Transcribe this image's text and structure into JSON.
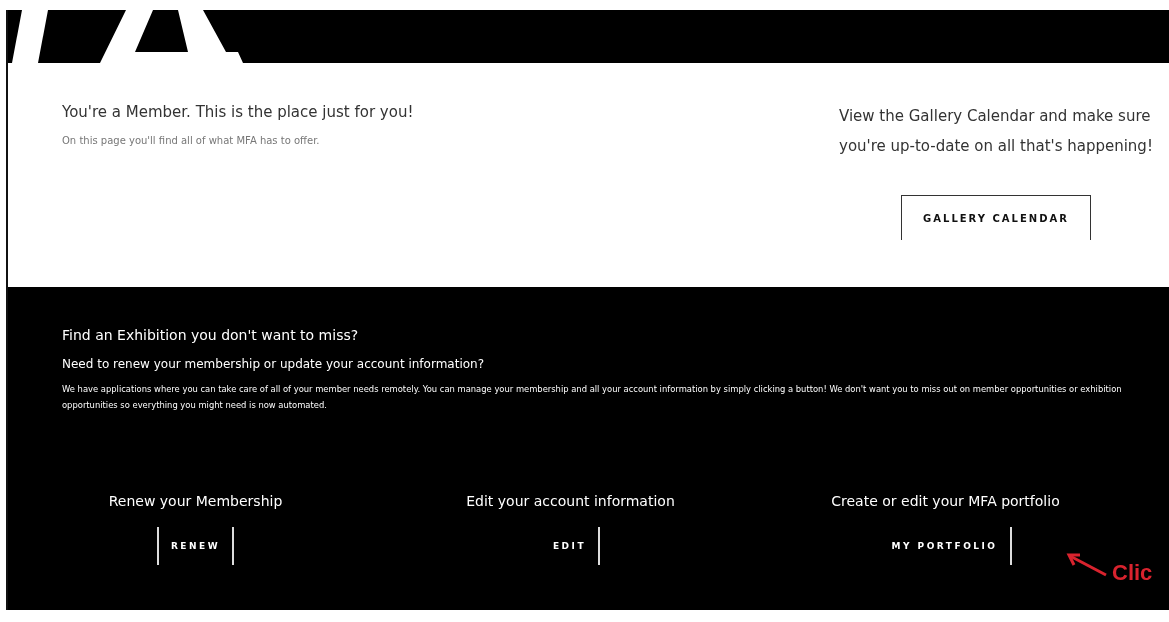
{
  "intro": {
    "heading": "You're a Member. This is the place just for you!",
    "subtitle": "On this page you'll find all of what MFA has to offer."
  },
  "calendar": {
    "text": "View the Gallery Calendar and make sure you're up-to-date on all that's happening!",
    "button": "GALLERY CALENDAR"
  },
  "member_section": {
    "heading": "Find an Exhibition you don't want to miss?",
    "subheading": "Need to renew your membership or update your account information?",
    "paragraph": "We have applications where you can take care of all of your member needs remotely. You can manage your membership and all your account information by simply clicking a button! We don't want you to miss out on member opportunities or exhibition opportunities so everything you might need is now automated.",
    "actions": [
      {
        "title": "Renew your Membership",
        "button": "RENEW",
        "left_rule": true
      },
      {
        "title": "Edit your account information",
        "button": "EDIT",
        "left_rule": false
      },
      {
        "title": "Create or edit your MFA portfolio",
        "button": "MY PORTFOLIO",
        "left_rule": false
      }
    ]
  },
  "annotation": {
    "text": "Clic"
  }
}
